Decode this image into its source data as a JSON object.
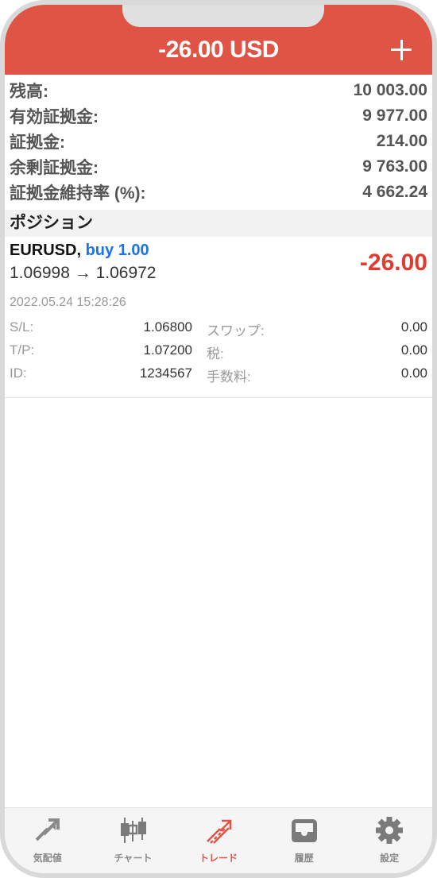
{
  "header": {
    "title": "-26.00 USD"
  },
  "summary": [
    {
      "label": "残高:",
      "value": "10 003.00"
    },
    {
      "label": "有効証拠金:",
      "value": "9 977.00"
    },
    {
      "label": "証拠金:",
      "value": "214.00"
    },
    {
      "label": "余剰証拠金:",
      "value": "9 763.00"
    },
    {
      "label": "証拠金維持率 (%):",
      "value": "4 662.24"
    }
  ],
  "positions_header": "ポジション",
  "position": {
    "symbol": "EURUSD,",
    "side": "buy 1.00",
    "prices": "1.06998 → 1.06972",
    "profit": "-26.00",
    "time": "2022.05.24 15:28:26",
    "rows": [
      {
        "k1": "S/L:",
        "v1": "1.06800",
        "k2": "スワップ:",
        "v2": "0.00"
      },
      {
        "k1": "T/P:",
        "v1": "1.07200",
        "k2": "税:",
        "v2": "0.00"
      },
      {
        "k1": "ID:",
        "v1": "1234567",
        "k2": "手数料:",
        "v2": "0.00"
      }
    ]
  },
  "tabs": [
    {
      "label": "気配値",
      "icon": "quotes-icon"
    },
    {
      "label": "チャート",
      "icon": "chart-icon"
    },
    {
      "label": "トレード",
      "icon": "trade-icon",
      "active": true
    },
    {
      "label": "履歴",
      "icon": "history-icon"
    },
    {
      "label": "設定",
      "icon": "settings-icon"
    }
  ],
  "colors": {
    "accent": "#e05445",
    "loss": "#e03b2f",
    "buy": "#1a73e8"
  }
}
